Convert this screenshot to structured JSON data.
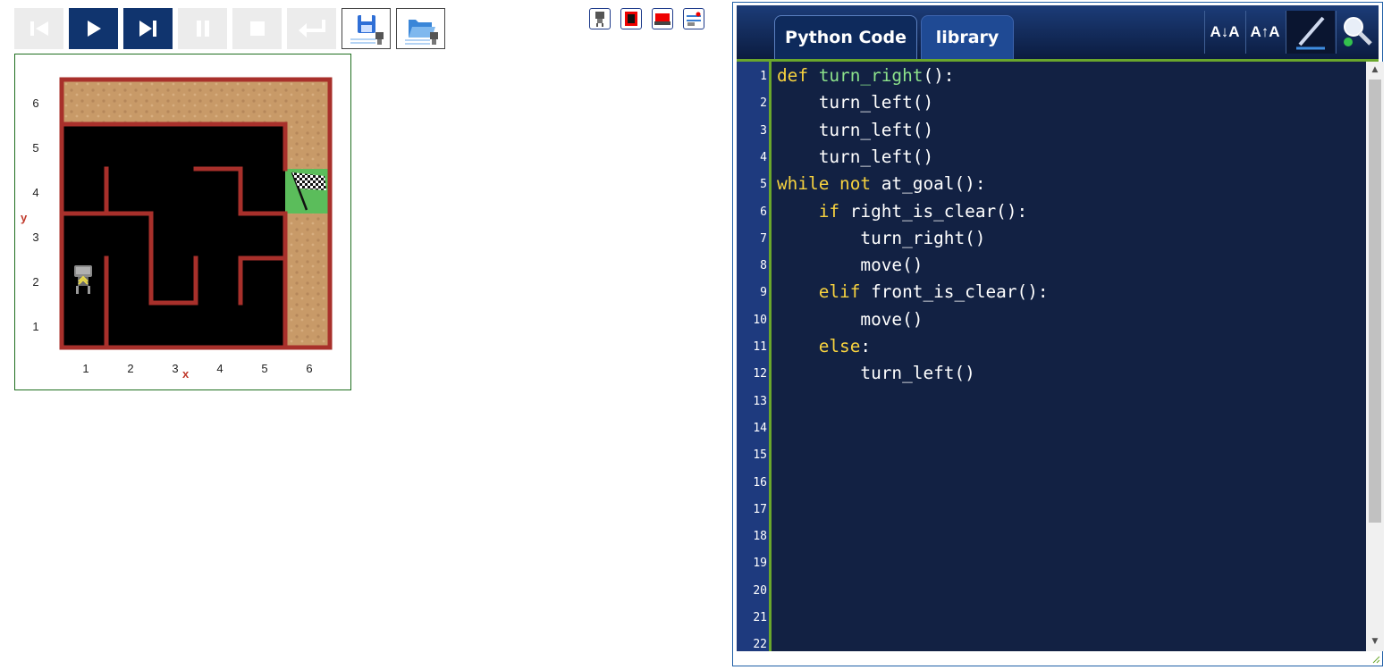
{
  "toolbar": {
    "buttons": [
      "skip-back",
      "run",
      "step",
      "pause",
      "stop",
      "return",
      "save-world",
      "open-world"
    ]
  },
  "world": {
    "x_ticks": [
      "1",
      "2",
      "3",
      "4",
      "5",
      "6"
    ],
    "y_ticks": [
      "6",
      "5",
      "4",
      "3",
      "2",
      "1"
    ],
    "x_axis_label": "x",
    "y_axis_label": "y",
    "robot_position": [
      1,
      2
    ],
    "goal_position": [
      6,
      4
    ],
    "colors": {
      "wall": "#a8302b",
      "floor": "#000000",
      "sand": "#c89a68",
      "goal_grass": "#5bbd5b"
    }
  },
  "editor": {
    "tabs": [
      "Python Code",
      "library"
    ],
    "active_tab": "Python Code",
    "tools": {
      "font_smaller": "A↓A",
      "font_larger": "A↑A",
      "edit_icon": "pencil-icon",
      "search_icon": "magnifier-icon"
    },
    "line_numbers": [
      "1",
      "2",
      "3",
      "4",
      "5",
      "6",
      "7",
      "8",
      "9",
      "10",
      "11",
      "12",
      "13",
      "14",
      "15",
      "16",
      "17",
      "18",
      "19",
      "20",
      "21",
      "22"
    ],
    "code_lines": [
      [
        {
          "t": "def ",
          "c": "kw"
        },
        {
          "t": "turn_right",
          "c": "fn"
        },
        {
          "t": "():",
          "c": "pl"
        }
      ],
      [
        {
          "t": "    turn_left()",
          "c": "pl"
        }
      ],
      [
        {
          "t": "    turn_left()",
          "c": "pl"
        }
      ],
      [
        {
          "t": "    turn_left()",
          "c": "pl"
        }
      ],
      [
        {
          "t": "while ",
          "c": "kw"
        },
        {
          "t": "not ",
          "c": "kw"
        },
        {
          "t": "at_goal():",
          "c": "pl"
        }
      ],
      [
        {
          "t": "    ",
          "c": "pl"
        },
        {
          "t": "if ",
          "c": "kw"
        },
        {
          "t": "right_is_clear():",
          "c": "pl"
        }
      ],
      [
        {
          "t": "        turn_right()",
          "c": "pl"
        }
      ],
      [
        {
          "t": "        move()",
          "c": "pl"
        }
      ],
      [
        {
          "t": "    ",
          "c": "pl"
        },
        {
          "t": "elif ",
          "c": "kw"
        },
        {
          "t": "front_is_clear():",
          "c": "pl"
        }
      ],
      [
        {
          "t": "        move()",
          "c": "pl"
        }
      ],
      [
        {
          "t": "    ",
          "c": "pl"
        },
        {
          "t": "else",
          "c": "kw"
        },
        {
          "t": ":",
          "c": "pl"
        }
      ],
      [
        {
          "t": "        turn_left()",
          "c": "pl"
        }
      ]
    ],
    "colors": {
      "background": "#122143",
      "gutter": "#1e3a7e",
      "keyword": "#f7d23f",
      "function_name": "#8ce28b",
      "gutter_border": "#6aa72c"
    }
  }
}
